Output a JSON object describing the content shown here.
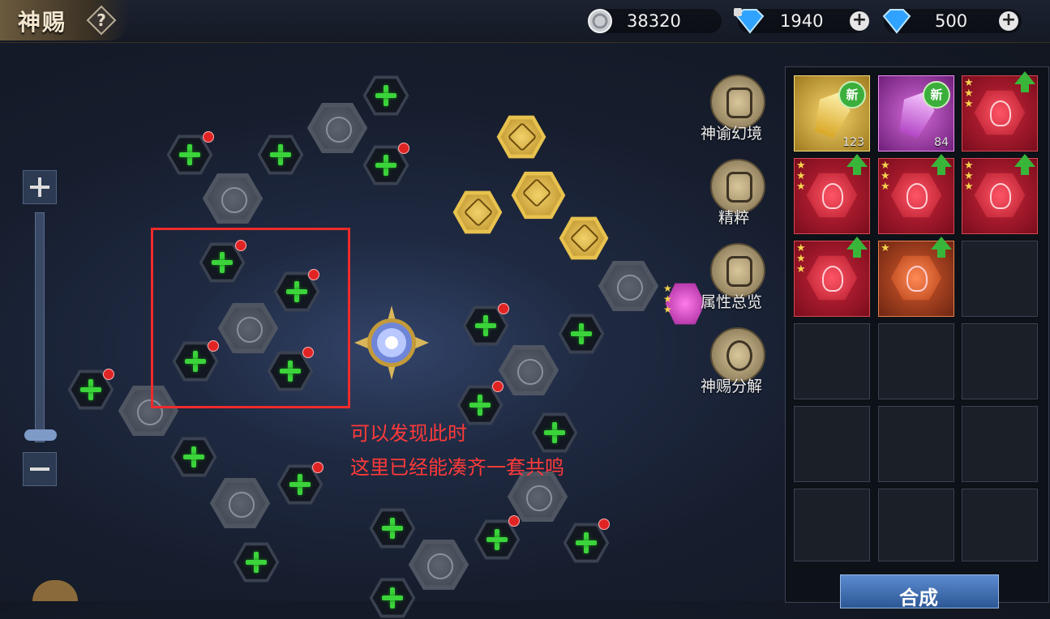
{
  "header": {
    "title": "神赐",
    "help_icon": "question-icon",
    "silver": {
      "icon": "silver-coin-icon",
      "value": "38320"
    },
    "bound_diamond": {
      "icon": "locked-diamond-icon",
      "value": "1940"
    },
    "diamond": {
      "icon": "diamond-icon",
      "value": "500"
    },
    "add_glyph": "+"
  },
  "zoom": {
    "plus": "+",
    "minus": "−"
  },
  "board": {
    "plus_glyph": "+"
  },
  "side_menu": [
    {
      "label": "神谕幻境",
      "icon": "tree-icon"
    },
    {
      "label": "精粹",
      "icon": "scroll-icon"
    },
    {
      "label": "属性总览",
      "icon": "scroll-icon"
    },
    {
      "label": "神赐分解",
      "icon": "swirl-icon"
    }
  ],
  "inventory": [
    {
      "type": "gold-crystal",
      "new": "新",
      "count": "123"
    },
    {
      "type": "pink-crystal",
      "new": "新",
      "count": "84"
    },
    {
      "type": "red",
      "stars": 3,
      "upgrade": true
    },
    {
      "type": "red",
      "stars": 3,
      "upgrade": true
    },
    {
      "type": "red",
      "stars": 3,
      "upgrade": true
    },
    {
      "type": "red",
      "stars": 3,
      "upgrade": true
    },
    {
      "type": "red",
      "stars": 3,
      "upgrade": true
    },
    {
      "type": "orange",
      "stars": 1,
      "upgrade": true
    }
  ],
  "craft_button": "合成",
  "colors": {
    "accent_red": "#ef2b2b",
    "node_green": "#3bd43b",
    "gold": "#e7c24e"
  },
  "annotation": {
    "line1": "可以发现此时",
    "line2": "这里已经能凑齐一套共鸣"
  }
}
